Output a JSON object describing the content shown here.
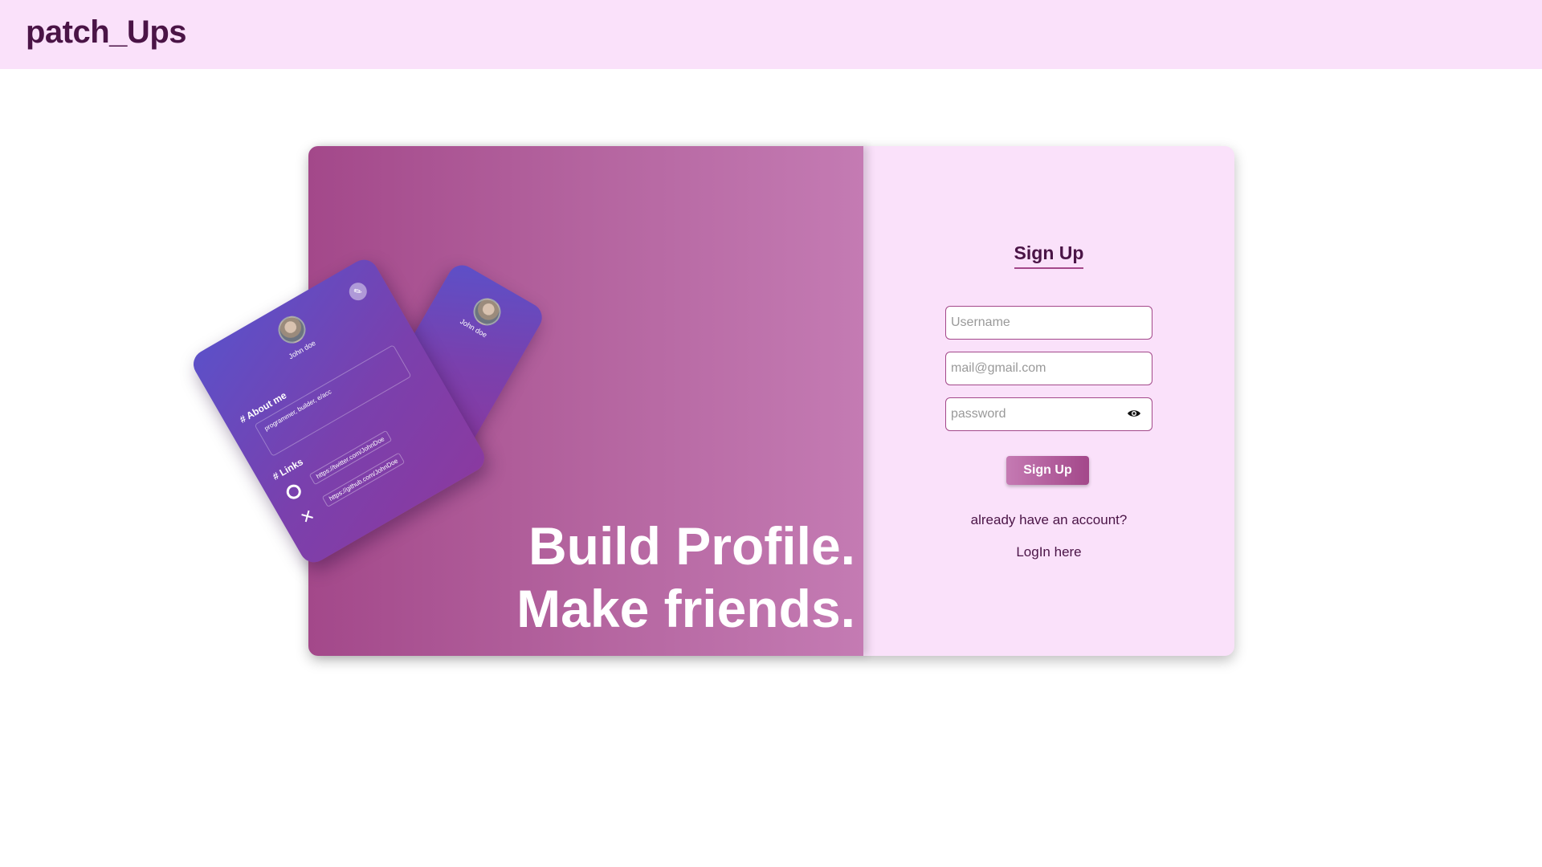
{
  "navbar": {
    "logo": "patch_Ups"
  },
  "hero": {
    "headline_line1": "Build Profile.",
    "headline_line2": "Make friends.",
    "gradient_colors": [
      "#a3488a",
      "#c47bb3"
    ]
  },
  "profile_card": {
    "name": "John doe",
    "about_title": "# About me",
    "about_text": "programmer, builder, e/acc",
    "links_title": "# Links",
    "links": [
      "https://twitter.com/JohnDoe",
      "https://github.com/JohnDoe"
    ],
    "icons": [
      "github-icon",
      "x-icon",
      "edit-icon"
    ]
  },
  "signup_form": {
    "title": "Sign Up",
    "username_placeholder": "Username",
    "email_placeholder": "mail@gmail.com",
    "password_placeholder": "password",
    "submit_label": "Sign Up",
    "login_prompt": "already have an account?",
    "login_link": "LogIn here"
  },
  "colors": {
    "navbar_bg": "#fae1fa",
    "brand_text": "#4a1446",
    "accent": "#a3488a",
    "card_purple": "#6a47c0"
  }
}
